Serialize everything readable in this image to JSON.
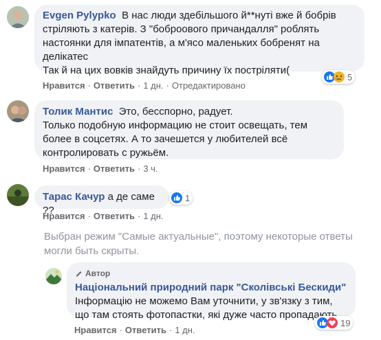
{
  "comments": [
    {
      "author": "Evgen Pylypko",
      "text": "В нас люди здебільшого й**нуті вже й бобрів стріляють з катерів. З \"боброового причандалля\" роблять настоянки для імпатентів, а м'ясо маленьких бобренят на делікатес\nТак й на цих вовків знайдуть причину їх постріляти(",
      "actions": {
        "like": "Нравится",
        "reply": "Ответить",
        "time": "1 дн.",
        "edited": "Отредактировано"
      },
      "reactions": {
        "count": "5",
        "types": [
          "like-icon",
          "sad-icon"
        ]
      }
    },
    {
      "author": "Толик Мантис",
      "text": "Это, бесспорно, радует.\nТолько подобную информацию не стоит освещать, тем более в соцсетях. А то зачешется у любителей всё контролировать с ружьём.",
      "actions": {
        "like": "Нравится",
        "reply": "Ответить",
        "time": "3 ч."
      }
    },
    {
      "author": "Тарас Качур",
      "text": "а де саме ??",
      "actions": {
        "like": "Нравится",
        "reply": "Ответить",
        "time": "1 дн."
      },
      "reactions": {
        "count": "1",
        "types": [
          "like-icon"
        ]
      }
    }
  ],
  "notice": "Выбран режим \"Самые актуальные\", поэтому некоторые ответы могли быть скрыты.",
  "reply": {
    "badge": "Автор",
    "author": "Національний природний парк \"Сколівські Бескиди\"",
    "text": "Інформацію не можемо Вам уточнити, у зв'язку з тим, що там стоять фотопастки, які дуже часто пропадають.",
    "actions": {
      "like": "Нравится",
      "reply": "Ответить",
      "time": "1 дн."
    },
    "reactions": {
      "count": "19",
      "types": [
        "like-icon",
        "love-icon"
      ]
    }
  },
  "colors": {
    "bubble": "#f0f2f5",
    "name": "#385898",
    "like": "#1877f2",
    "love": "#f33e58",
    "sad": "#f7b125"
  }
}
